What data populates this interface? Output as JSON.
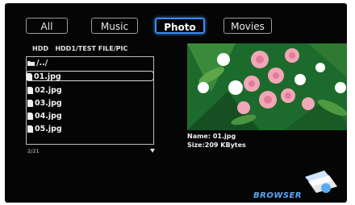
{
  "tabs": [
    {
      "label": "All"
    },
    {
      "label": "Music"
    },
    {
      "label": "Photo"
    },
    {
      "label": "Movies"
    }
  ],
  "browser": {
    "drive_label": "HDD",
    "path": "HDD1/TEST FILE/PIC"
  },
  "file_list": {
    "items": [
      {
        "name": "/../",
        "type": "folder"
      },
      {
        "name": "01.jpg",
        "type": "file"
      },
      {
        "name": "02.jpg",
        "type": "file"
      },
      {
        "name": "03.jpg",
        "type": "file"
      },
      {
        "name": "04.jpg",
        "type": "file"
      },
      {
        "name": "05.jpg",
        "type": "file"
      }
    ],
    "page_indicator": "2/21"
  },
  "preview": {
    "name": "Name: 01.jpg",
    "size": "Size:209 KBytes"
  },
  "logo": {
    "text": "BROWSER"
  },
  "colors": {
    "accent": "#3b8bf0",
    "background": "#050505",
    "logo": "#5aa9f5"
  }
}
